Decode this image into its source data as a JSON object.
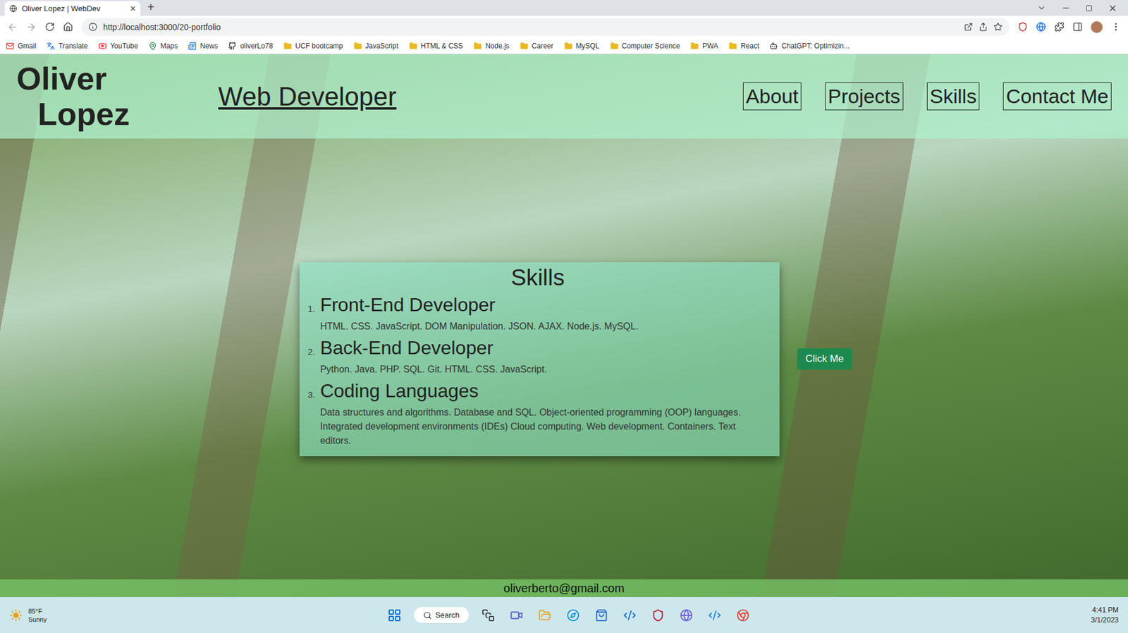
{
  "browser": {
    "tab": {
      "title": "Oliver Lopez | WebDev",
      "close": "×"
    },
    "new_tab": "+",
    "url": "http://localhost:3000/20-portfolio",
    "bookmarks": [
      {
        "label": "Gmail",
        "kind": "mail"
      },
      {
        "label": "Translate",
        "kind": "translate"
      },
      {
        "label": "YouTube",
        "kind": "video"
      },
      {
        "label": "Maps",
        "kind": "map"
      },
      {
        "label": "News",
        "kind": "news"
      },
      {
        "label": "oliverLo78",
        "kind": "github"
      },
      {
        "label": "UCF bootcamp",
        "kind": "folder"
      },
      {
        "label": "JavaScript",
        "kind": "folder"
      },
      {
        "label": "HTML & CSS",
        "kind": "folder"
      },
      {
        "label": "Node.js",
        "kind": "folder"
      },
      {
        "label": "Career",
        "kind": "folder"
      },
      {
        "label": "MySQL",
        "kind": "folder"
      },
      {
        "label": "Computer Science",
        "kind": "folder"
      },
      {
        "label": "PWA",
        "kind": "folder"
      },
      {
        "label": "React",
        "kind": "folder"
      },
      {
        "label": "ChatGPT: Optimizin...",
        "kind": "bot"
      }
    ]
  },
  "page": {
    "name": [
      "Oliver",
      "Lopez"
    ],
    "title": "Web Developer",
    "nav": [
      "About",
      "Projects",
      "Skills",
      "Contact Me"
    ],
    "skills": {
      "heading": "Skills",
      "items": [
        {
          "number": "1.",
          "title": "Front-End Developer",
          "text": "HTML. CSS. JavaScript. DOM Manipulation. JSON. AJAX. Node.js. MySQL."
        },
        {
          "number": "2.",
          "title": "Back-End Developer",
          "text": "Python. Java. PHP. SQL. Git. HTML. CSS. JavaScript."
        },
        {
          "number": "3.",
          "title": "Coding Languages",
          "text": "Data structures and algorithms. Database and SQL. Object-oriented programming (OOP) languages. Integrated development environments (IDEs) Cloud computing. Web development. Containers. Text editors."
        }
      ]
    },
    "button": "Click Me",
    "footer": "oliverberto@gmail.com"
  },
  "taskbar": {
    "weather": {
      "temp": "85°F",
      "condition": "Sunny"
    },
    "search": "Search",
    "time": "4:41 PM",
    "date": "3/1/2023"
  }
}
